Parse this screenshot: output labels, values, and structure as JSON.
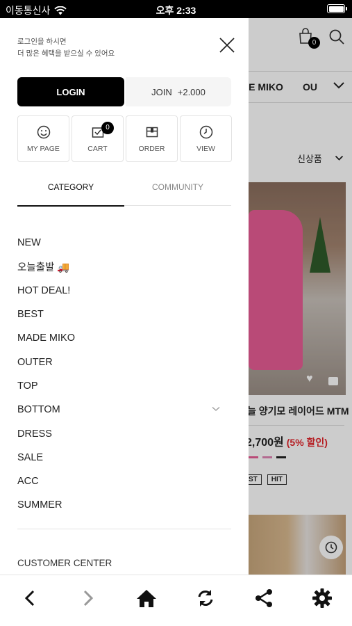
{
  "status_bar": {
    "carrier": "이동통신사",
    "time": "오후 2:33"
  },
  "background": {
    "cart_count": "0",
    "nav": [
      "DE MIKO",
      "OU"
    ],
    "sort_label": "신상품",
    "product_title": "늘 양기모 레이어드 MTM",
    "product_price": "2,700원",
    "product_discount": "(5% 할인)",
    "tags": [
      "ST",
      "HIT"
    ],
    "swatch_colors": [
      "#e85d95",
      "#e085b5",
      "#222222"
    ]
  },
  "drawer": {
    "login_message_line1": "로그인을 하시면",
    "login_message_line2": "더 많은 혜택을 받으실 수 있어요",
    "login_label": "LOGIN",
    "join_label": "JOIN",
    "join_bonus": "+2.000",
    "quick_links": [
      {
        "label": "MY PAGE",
        "icon": "smile-icon"
      },
      {
        "label": "CART",
        "icon": "cart-check-icon",
        "badge": "0"
      },
      {
        "label": "ORDER",
        "icon": "box-icon"
      },
      {
        "label": "VIEW",
        "icon": "clock-icon"
      }
    ],
    "tabs": [
      "CATEGORY",
      "COMMUNITY"
    ],
    "categories": [
      "NEW",
      "오늘출발 🚚",
      "HOT DEAL!",
      "BEST",
      "MADE MIKO",
      "OUTER",
      "TOP",
      "BOTTOM",
      "DRESS",
      "SALE",
      "ACC",
      "SUMMER"
    ],
    "customer_center": "CUSTOMER CENTER"
  },
  "toolbar": [
    "back-icon",
    "forward-icon",
    "home-icon",
    "refresh-icon",
    "share-icon",
    "settings-icon"
  ],
  "colors": {
    "accent": "#000000",
    "discount": "#e3252b"
  }
}
